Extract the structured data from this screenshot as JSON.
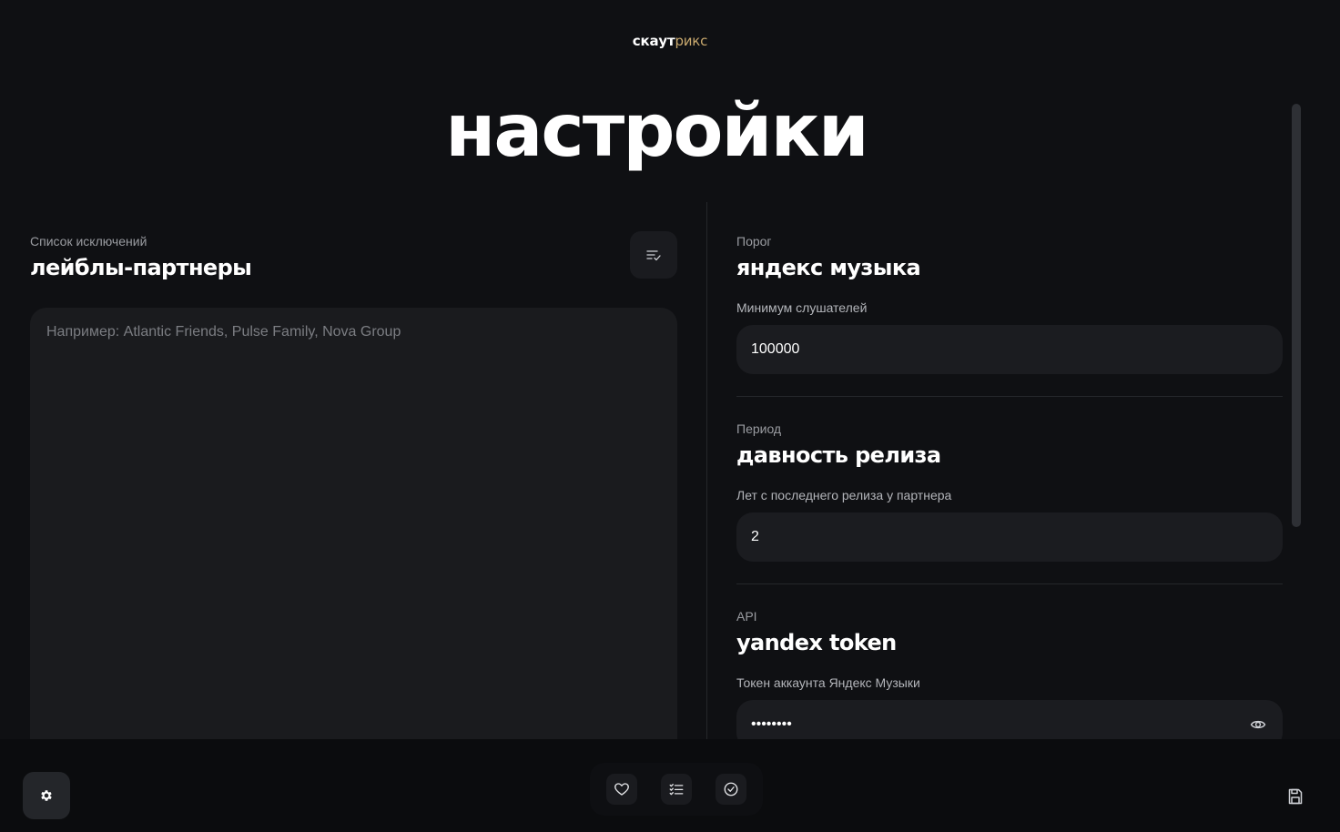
{
  "logo": {
    "part1": "скаут",
    "part2": "рикс"
  },
  "page_title": "настройки",
  "exclusions": {
    "eyebrow": "Список исключений",
    "heading": "лейблы-партнеры",
    "placeholder": "Например: Atlantic Friends, Pulse Family, Nova Group",
    "value": "",
    "list_button_icon": "list-check-icon"
  },
  "settings": [
    {
      "eyebrow": "Порог",
      "heading": "яндекс музыка",
      "label": "Минимум слушателей",
      "value": "100000"
    },
    {
      "eyebrow": "Период",
      "heading": "давность релиза",
      "label": "Лет с последнего релиза у партнера",
      "value": "2"
    },
    {
      "eyebrow": "API",
      "heading": "yandex token",
      "label": "Токен аккаунта Яндекс Музыки",
      "value": "••••••••",
      "toggle_icon": "eye-icon"
    }
  ],
  "bottom_nav": {
    "settings_icon": "gear-icon",
    "items": [
      {
        "icon": "heart-icon"
      },
      {
        "icon": "list-check-icon"
      },
      {
        "icon": "check-circle-icon"
      }
    ],
    "save_icon": "floppy-disk-icon"
  },
  "colors": {
    "background": "#0f1013",
    "surface": "#1b1c20",
    "accent_gold": "#c9a96e",
    "text_muted": "#9a9ca1"
  }
}
